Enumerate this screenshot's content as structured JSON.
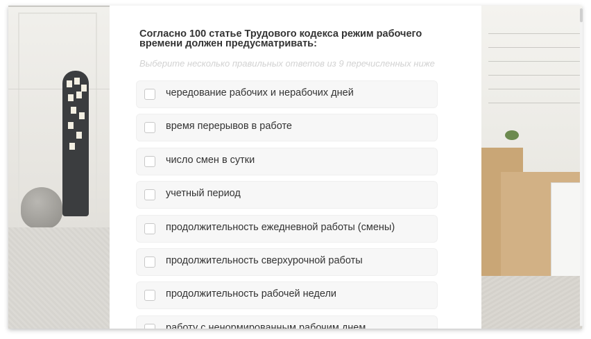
{
  "quiz": {
    "question": "Согласно 100 статье Трудового кодекса режим рабочего времени должен предусматривать:",
    "hint": "Выберите несколько правильных ответов из 9 перечисленных ниже",
    "options": [
      {
        "label": "чередование рабочих и нерабочих дней",
        "checked": false
      },
      {
        "label": "время перерывов в работе",
        "checked": false
      },
      {
        "label": "число смен в сутки",
        "checked": false
      },
      {
        "label": "учетный период",
        "checked": false
      },
      {
        "label": "продолжительность ежедневной работы (смены)",
        "checked": false
      },
      {
        "label": "продолжительность сверхурочной работы",
        "checked": false
      },
      {
        "label": "продолжительность рабочей недели",
        "checked": false
      },
      {
        "label": "работу с ненормированным рабочим днем",
        "checked": false
      }
    ]
  },
  "colors": {
    "question_text": "#333333",
    "hint_text": "#d2d2d2",
    "option_bg": "#f7f7f7",
    "checkbox_border": "#c7c7c7",
    "panel_bg": "#ffffff"
  }
}
